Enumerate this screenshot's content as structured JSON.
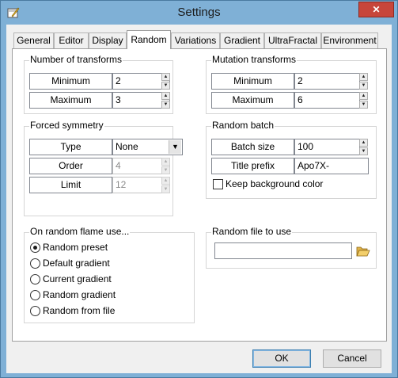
{
  "window": {
    "title": "Settings",
    "close_glyph": "✕",
    "app_icon": "settings-app-icon"
  },
  "tabs": [
    {
      "label": "General",
      "active": false
    },
    {
      "label": "Editor",
      "active": false
    },
    {
      "label": "Display",
      "active": false
    },
    {
      "label": "Random",
      "active": true
    },
    {
      "label": "Variations",
      "active": false
    },
    {
      "label": "Gradient",
      "active": false
    },
    {
      "label": "UltraFractal",
      "active": false
    },
    {
      "label": "Environment",
      "active": false
    }
  ],
  "number_of_transforms": {
    "title": "Number of transforms",
    "minimum_label": "Minimum",
    "minimum_value": "2",
    "maximum_label": "Maximum",
    "maximum_value": "3"
  },
  "mutation_transforms": {
    "title": "Mutation transforms",
    "minimum_label": "Minimum",
    "minimum_value": "2",
    "maximum_label": "Maximum",
    "maximum_value": "6"
  },
  "forced_symmetry": {
    "title": "Forced symmetry",
    "type_label": "Type",
    "type_value": "None",
    "order_label": "Order",
    "order_value": "4",
    "limit_label": "Limit",
    "limit_value": "12"
  },
  "random_batch": {
    "title": "Random batch",
    "batch_size_label": "Batch size",
    "batch_size_value": "100",
    "title_prefix_label": "Title prefix",
    "title_prefix_value": "Apo7X-",
    "keep_background_label": "Keep background color",
    "keep_background_checked": false
  },
  "on_random_flame": {
    "title": "On random flame use...",
    "options": [
      {
        "label": "Random preset",
        "checked": true
      },
      {
        "label": "Default gradient",
        "checked": false
      },
      {
        "label": "Current gradient",
        "checked": false
      },
      {
        "label": "Random gradient",
        "checked": false
      },
      {
        "label": "Random from file",
        "checked": false
      }
    ]
  },
  "random_file": {
    "title": "Random file to use",
    "path_value": "",
    "browse_icon": "folder-open-icon"
  },
  "buttons": {
    "ok": "OK",
    "cancel": "Cancel"
  },
  "spin_glyphs": {
    "up": "▲",
    "down": "▼",
    "dropdown": "▼"
  }
}
